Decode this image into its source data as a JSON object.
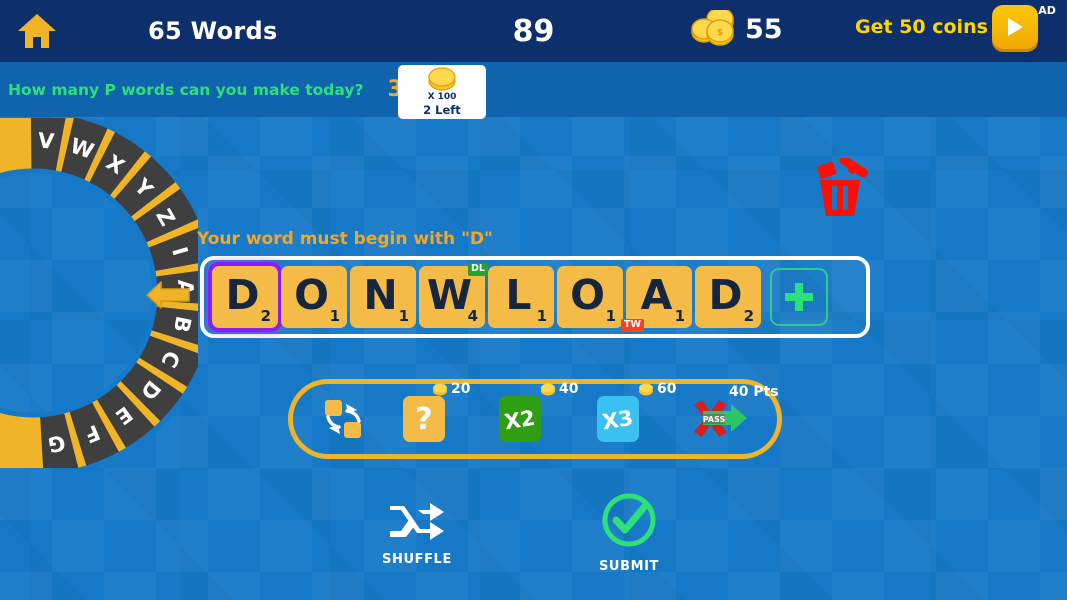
{
  "header": {
    "home_icon": "home-icon",
    "words_count": "65 Words",
    "score": "89",
    "coins_icon": "coin-stack-icon",
    "coins": "55",
    "ad_label": "Get 50 coins",
    "ad_play_icon": "play-icon",
    "ad_sup": "AD"
  },
  "challenge": {
    "question": "How many P words can you make today?",
    "count": "3",
    "reward_multiplier": "X 100",
    "attempts_left": "2 Left",
    "reward_icon": "coin-stack-icon"
  },
  "wheel": {
    "letters": [
      "V",
      "W",
      "X",
      "Y",
      "Z",
      "I",
      "A",
      "B",
      "C",
      "D",
      "E",
      "F",
      "G"
    ],
    "selected_letter": "A",
    "pointer_icon": "wheel-pointer-icon"
  },
  "board": {
    "prompt": "Your word must begin with \"D\"",
    "tiles": [
      {
        "letter": "D",
        "points": "2",
        "badge": "",
        "selected": true
      },
      {
        "letter": "O",
        "points": "1",
        "badge": "",
        "selected": false
      },
      {
        "letter": "N",
        "points": "1",
        "badge": "",
        "selected": false
      },
      {
        "letter": "W",
        "points": "4",
        "badge": "DL",
        "selected": false
      },
      {
        "letter": "L",
        "points": "1",
        "badge": "",
        "selected": false
      },
      {
        "letter": "O",
        "points": "1",
        "badge": "",
        "selected": false
      },
      {
        "letter": "A",
        "points": "1",
        "badge": "TW",
        "selected": false
      },
      {
        "letter": "D",
        "points": "2",
        "badge": "",
        "selected": false
      }
    ],
    "add_tile_icon": "plus-icon",
    "trash_icon": "trash-icon"
  },
  "powerups": [
    {
      "name": "swap",
      "icon": "swap-icon",
      "cost": "",
      "label": ""
    },
    {
      "name": "hint",
      "icon": "question-mark-icon",
      "cost": "20",
      "label": "?"
    },
    {
      "name": "multiplier-2x",
      "icon": "x2-icon",
      "cost": "40",
      "label": "X2"
    },
    {
      "name": "multiplier-3x",
      "icon": "x3-icon",
      "cost": "60",
      "label": "X3"
    },
    {
      "name": "pass",
      "icon": "pass-arrow-icon",
      "cost": "",
      "label": "PASS",
      "points": "40 Pts"
    }
  ],
  "actions": {
    "shuffle_label": "SHUFFLE",
    "shuffle_icon": "shuffle-icon",
    "submit_label": "SUBMIT",
    "submit_icon": "check-circle-icon"
  },
  "colors": {
    "background": "#1579c8",
    "header": "#0d2f6b",
    "challenge_bar": "#1063ad",
    "tile": "#f5bb47",
    "accent_yellow": "#f0b429",
    "green": "#2ee07a",
    "select_purple": "#8a1df0",
    "trash_red": "#fa1005"
  }
}
